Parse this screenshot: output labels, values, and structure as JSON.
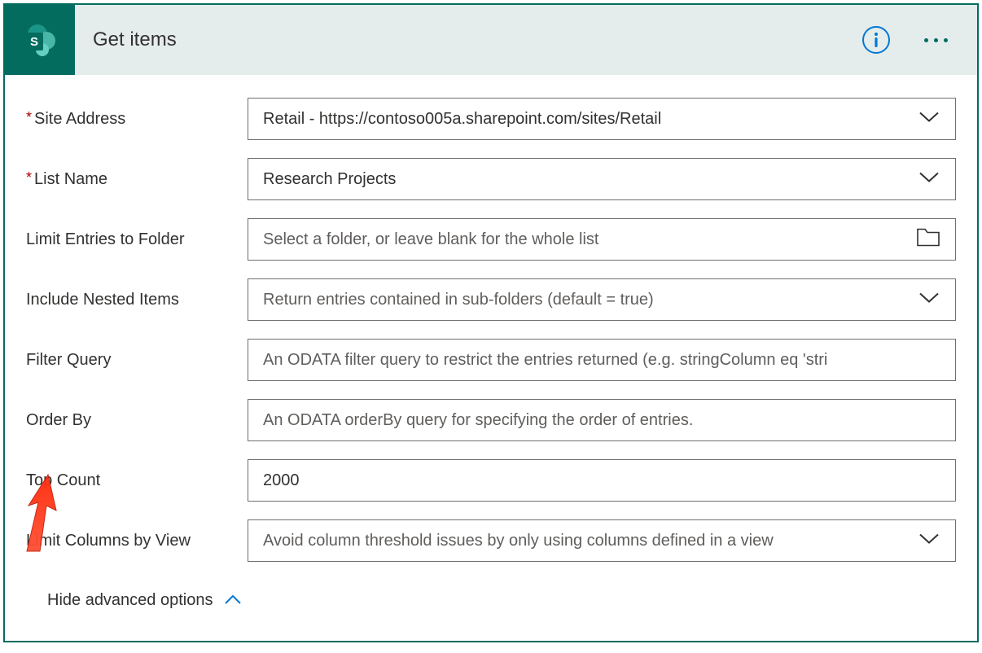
{
  "header": {
    "title": "Get items",
    "appIconName": "sharepoint-icon"
  },
  "fields": {
    "siteAddress": {
      "label": "Site Address",
      "required": true,
      "value": "Retail - https://contoso005a.sharepoint.com/sites/Retail"
    },
    "listName": {
      "label": "List Name",
      "required": true,
      "value": "Research Projects"
    },
    "limitFolder": {
      "label": "Limit Entries to Folder",
      "placeholder": "Select a folder, or leave blank for the whole list"
    },
    "includeNested": {
      "label": "Include Nested Items",
      "placeholder": "Return entries contained in sub-folders (default = true)"
    },
    "filterQuery": {
      "label": "Filter Query",
      "placeholder": "An ODATA filter query to restrict the entries returned (e.g. stringColumn eq 'stri"
    },
    "orderBy": {
      "label": "Order By",
      "placeholder": "An ODATA orderBy query for specifying the order of entries."
    },
    "topCount": {
      "label": "Top Count",
      "value": "2000"
    },
    "limitColumns": {
      "label": "Limit Columns by View",
      "placeholder": "Avoid column threshold issues by only using columns defined in a view"
    }
  },
  "advancedToggle": {
    "label": "Hide advanced options"
  },
  "colors": {
    "accent": "#036c5f",
    "headerBg": "#e4edec",
    "text": "#323130",
    "placeholder": "#605e5c",
    "required": "#a80000",
    "infoIcon": "#0078d4"
  }
}
